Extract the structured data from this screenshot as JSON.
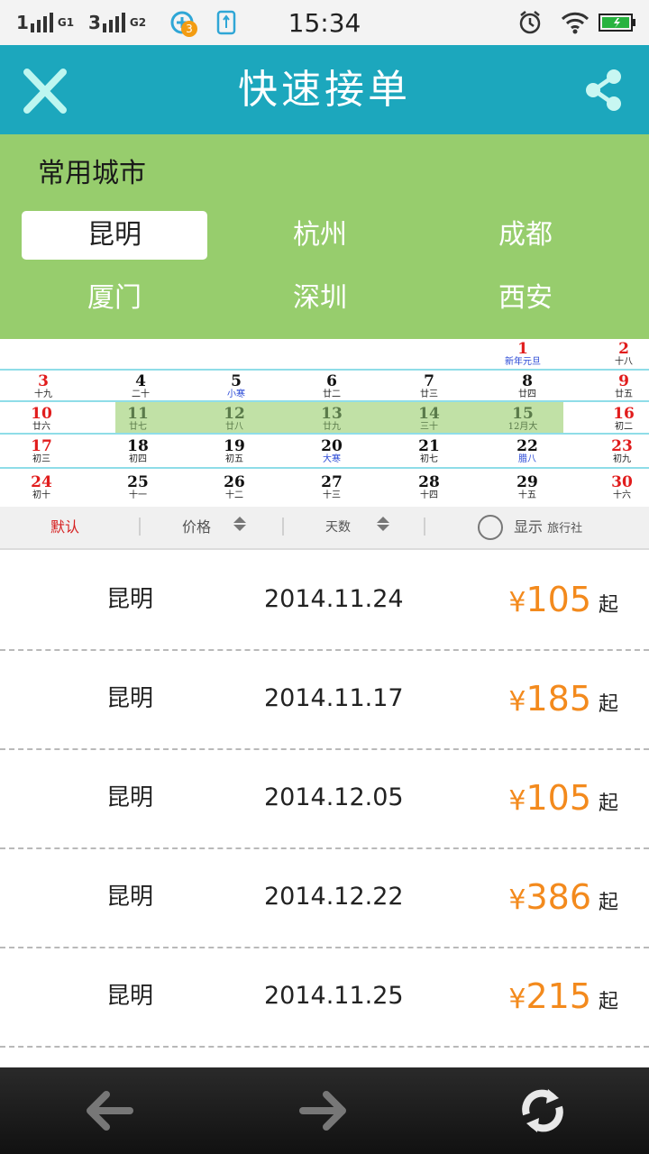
{
  "status_bar": {
    "time": "15:34",
    "signal_1": "1",
    "signal_1_net": "G1",
    "signal_2": "3",
    "signal_2_net": "G2",
    "notification_count": "3",
    "icons": [
      "signal-icon",
      "signal-icon",
      "notification-icon",
      "usb-icon",
      "alarm-icon",
      "wifi-icon",
      "battery-icon"
    ]
  },
  "header": {
    "title": "快速接单",
    "close_icon": "close-icon",
    "share_icon": "share-icon"
  },
  "cities": {
    "title": "常用城市",
    "selected": "昆明",
    "items": [
      {
        "label": "昆明"
      },
      {
        "label": "杭州"
      },
      {
        "label": "成都"
      },
      {
        "label": "厦门"
      },
      {
        "label": "深圳"
      },
      {
        "label": "西安"
      }
    ]
  },
  "calendar": {
    "highlight_range": [
      "11",
      "15"
    ],
    "days": [
      {
        "num": "1",
        "lunar": "新年元旦"
      },
      {
        "num": "2",
        "lunar": "十八"
      },
      {
        "num": "3",
        "lunar": "十九"
      },
      {
        "num": "4",
        "lunar": "二十"
      },
      {
        "num": "5",
        "lunar": "小寒"
      },
      {
        "num": "6",
        "lunar": "廿二"
      },
      {
        "num": "7",
        "lunar": "廿三"
      },
      {
        "num": "8",
        "lunar": "廿四"
      },
      {
        "num": "9",
        "lunar": "廿五"
      },
      {
        "num": "10",
        "lunar": "廿六"
      },
      {
        "num": "11",
        "lunar": "廿七"
      },
      {
        "num": "12",
        "lunar": "廿八"
      },
      {
        "num": "13",
        "lunar": "廿九"
      },
      {
        "num": "14",
        "lunar": "三十"
      },
      {
        "num": "15",
        "lunar": "12月大"
      },
      {
        "num": "16",
        "lunar": "初二"
      },
      {
        "num": "17",
        "lunar": "初三"
      },
      {
        "num": "18",
        "lunar": "初四"
      },
      {
        "num": "19",
        "lunar": "初五"
      },
      {
        "num": "20",
        "lunar": "大寒"
      },
      {
        "num": "21",
        "lunar": "初七"
      },
      {
        "num": "22",
        "lunar": "腊八"
      },
      {
        "num": "23",
        "lunar": "初九"
      },
      {
        "num": "24",
        "lunar": "初十"
      },
      {
        "num": "25",
        "lunar": "十一"
      },
      {
        "num": "26",
        "lunar": "十二"
      },
      {
        "num": "27",
        "lunar": "十三"
      },
      {
        "num": "28",
        "lunar": "十四"
      },
      {
        "num": "29",
        "lunar": "十五"
      },
      {
        "num": "30",
        "lunar": "十六"
      }
    ]
  },
  "sort_bar": {
    "default_label": "默认",
    "price_label": "价格",
    "days_label": "天数",
    "show_label": "显示",
    "agency_label": "旅行社"
  },
  "orders": [
    {
      "city": "昆明",
      "date": "2014.11.24",
      "currency": "¥",
      "price": "105",
      "suffix": "起"
    },
    {
      "city": "昆明",
      "date": "2014.11.17",
      "currency": "¥",
      "price": "185",
      "suffix": "起"
    },
    {
      "city": "昆明",
      "date": "2014.12.05",
      "currency": "¥",
      "price": "105",
      "suffix": "起"
    },
    {
      "city": "昆明",
      "date": "2014.12.22",
      "currency": "¥",
      "price": "386",
      "suffix": "起"
    },
    {
      "city": "昆明",
      "date": "2014.11.25",
      "currency": "¥",
      "price": "215",
      "suffix": "起"
    }
  ],
  "bottom_nav": {
    "icons": [
      "back-arrow-icon",
      "forward-arrow-icon",
      "refresh-icon"
    ]
  },
  "colors": {
    "header": "#1ca7bd",
    "city_panel": "#97cd6d",
    "price": "#f38a1d",
    "weekend": "#e11c1c",
    "highlight": "#c1e1a6"
  }
}
